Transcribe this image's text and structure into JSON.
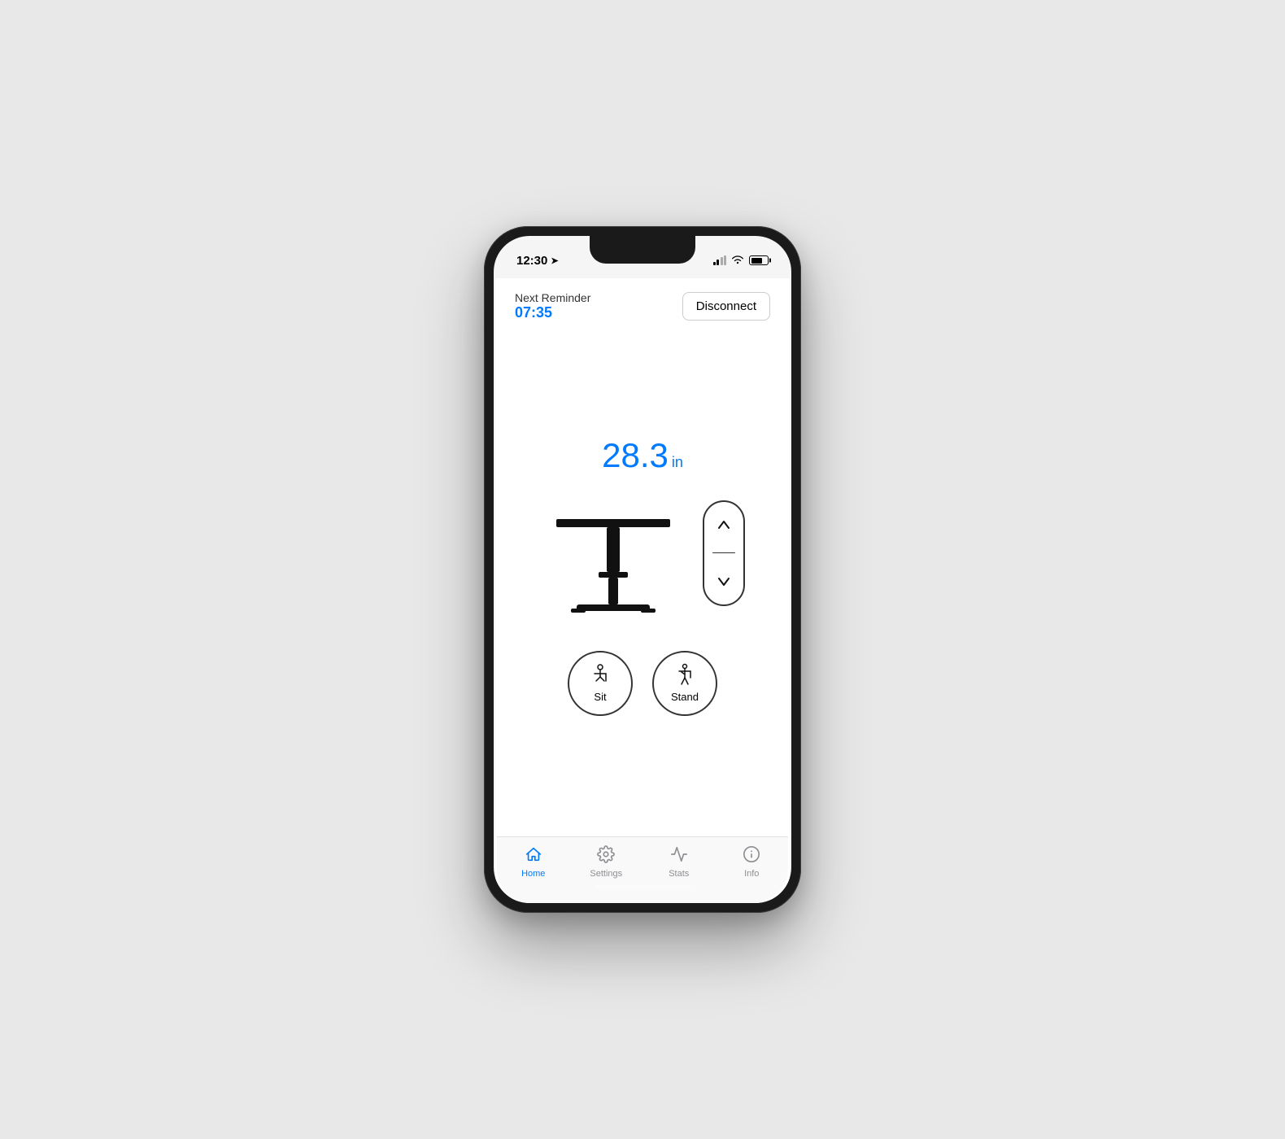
{
  "statusBar": {
    "time": "12:30",
    "timeIcon": "↗"
  },
  "header": {
    "reminderLabel": "Next Reminder",
    "reminderTime": "07:35",
    "disconnectLabel": "Disconnect"
  },
  "desk": {
    "heightValue": "28.3",
    "heightUnit": "in"
  },
  "presets": [
    {
      "label": "Sit",
      "id": "sit"
    },
    {
      "label": "Stand",
      "id": "stand"
    }
  ],
  "tabBar": {
    "tabs": [
      {
        "id": "home",
        "label": "Home",
        "active": true
      },
      {
        "id": "settings",
        "label": "Settings",
        "active": false
      },
      {
        "id": "stats",
        "label": "Stats",
        "active": false
      },
      {
        "id": "info",
        "label": "Info",
        "active": false
      }
    ]
  }
}
